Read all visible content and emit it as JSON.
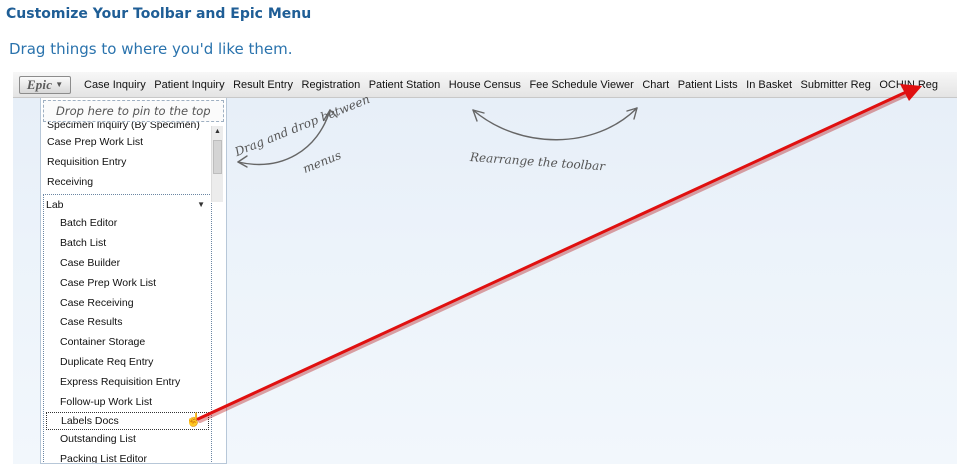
{
  "header": {
    "title": "Customize Your Toolbar and Epic Menu",
    "subtitle": "Drag things to where you'd like them."
  },
  "toolbar": {
    "epic_label": "Epic",
    "items": [
      "Case Inquiry",
      "Patient Inquiry",
      "Result Entry",
      "Registration",
      "Patient Station",
      "House Census",
      "Fee Schedule Viewer",
      "Chart",
      "Patient Lists",
      "In Basket",
      "Submitter Reg",
      "OCHIN Reg"
    ]
  },
  "menu": {
    "drop_zone": "Drop here to pin to the top",
    "top_items": [
      "Specimen Inquiry (By Specimen)",
      "Case Prep Work List",
      "Requisition Entry",
      "Receiving"
    ],
    "group": {
      "label": "Lab",
      "items": [
        "Batch Editor",
        "Batch List",
        "Case Builder",
        "Case Prep Work List",
        "Case Receiving",
        "Case Results",
        "Container Storage",
        "Duplicate Req Entry",
        "Express Requisition Entry",
        "Follow-up Work List",
        "Labels Docs",
        "Outstanding List",
        "Packing List Editor"
      ]
    }
  },
  "annotations": {
    "between_menus_line1": "Drag and drop between",
    "between_menus_line2": "menus",
    "rearrange": "Rearrange the toolbar"
  },
  "colors": {
    "title": "#1f5e96",
    "subtitle": "#2a73ad",
    "arrow": "#e01010"
  }
}
